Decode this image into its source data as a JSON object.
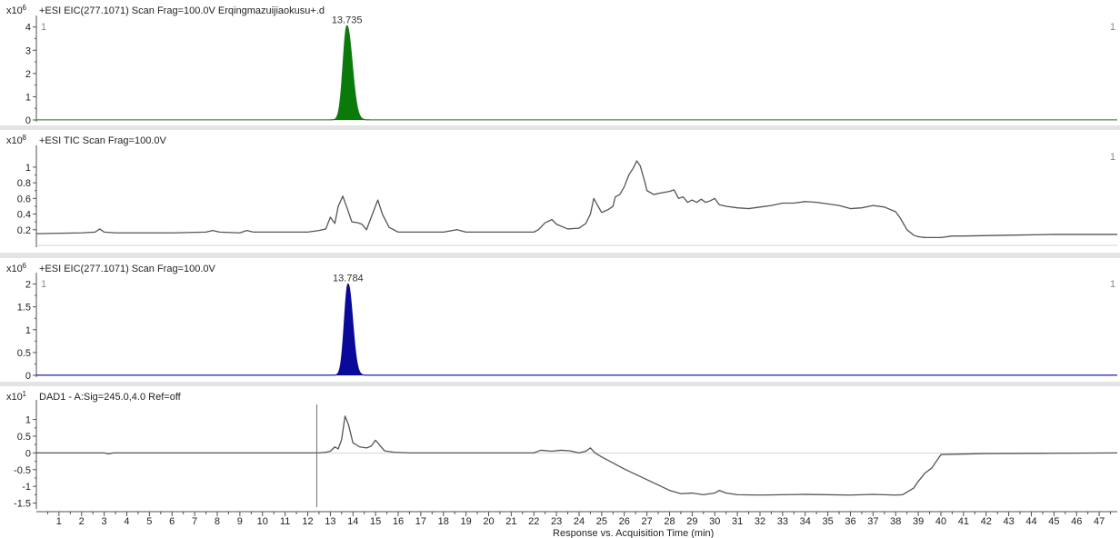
{
  "colors": {
    "panel_bg": "#ffffff",
    "separator_band": "#e4e4e4",
    "axis": "#505050",
    "trace_eic": "#1a7a1a",
    "fill_eic1": "#0a7a0a",
    "trace_tic": "#555555",
    "fill_eic2": "#0a0a9a",
    "trace_dad": "#555555",
    "marker": "#707070"
  },
  "x_axis": {
    "label": "Response vs. Acquisition Time (min)",
    "range": [
      0,
      47.8
    ],
    "ticks": [
      1,
      2,
      3,
      4,
      5,
      6,
      7,
      8,
      9,
      10,
      11,
      12,
      13,
      14,
      15,
      16,
      17,
      18,
      19,
      20,
      21,
      22,
      23,
      24,
      25,
      26,
      27,
      28,
      29,
      30,
      31,
      32,
      33,
      34,
      35,
      36,
      37,
      38,
      39,
      40,
      41,
      42,
      43,
      44,
      45,
      46,
      47
    ],
    "minor_step": 0.5
  },
  "chart_data": [
    {
      "type": "area",
      "title": "+ESI EIC(277.1071) Scan Frag=100.0V Erqingmazuijiaokusu+.d",
      "scale_label": "x10",
      "scale_exp": "6",
      "ylim": [
        0,
        4.3
      ],
      "yticks": [
        0,
        1,
        2,
        3,
        4
      ],
      "corner_left": "1",
      "corner_right": "1",
      "fill_color": "fill_eic1",
      "line_color": "trace_eic",
      "baseline": 0.005,
      "peaks": [
        {
          "rt": 13.735,
          "height": 4.05,
          "sigma_left": 0.17,
          "sigma_right": 0.23,
          "label": "13.735"
        }
      ],
      "fill_range": [
        13.1,
        15.3
      ],
      "noise": []
    },
    {
      "type": "line",
      "title": "+ESI TIC Scan Frag=100.0V",
      "scale_label": "x10",
      "scale_exp": "8",
      "ylim": [
        0,
        1.22
      ],
      "yticks": [
        0.2,
        0.4,
        0.6,
        0.8,
        1
      ],
      "corner_left": "",
      "corner_right": "1",
      "line_color": "trace_tic",
      "x": [
        0,
        2,
        2.6,
        2.8,
        3,
        3.5,
        6,
        7.5,
        7.8,
        8.1,
        9,
        9.3,
        9.6,
        12,
        12.5,
        12.8,
        13,
        13.2,
        13.35,
        13.55,
        13.75,
        13.95,
        14.2,
        14.4,
        14.6,
        14.9,
        15.1,
        15.3,
        15.6,
        16,
        18,
        18.6,
        19,
        20,
        22,
        22.2,
        22.5,
        22.8,
        23,
        23.5,
        24,
        24.3,
        24.5,
        24.65,
        24.8,
        25,
        25.3,
        25.5,
        25.6,
        25.8,
        26,
        26.2,
        26.4,
        26.55,
        26.7,
        26.9,
        27,
        27.3,
        27.6,
        28,
        28.2,
        28.4,
        28.6,
        28.8,
        29,
        29.2,
        29.4,
        29.6,
        29.8,
        30,
        30.2,
        30.5,
        31,
        31.5,
        32,
        32.5,
        33,
        33.5,
        34,
        34.5,
        35,
        35.5,
        36,
        36.5,
        37,
        37.5,
        38,
        38.2,
        38.5,
        38.8,
        39,
        39.3,
        39.6,
        40,
        40.5,
        41,
        43,
        45,
        47.8
      ],
      "y": [
        0.15,
        0.16,
        0.17,
        0.21,
        0.17,
        0.16,
        0.16,
        0.17,
        0.19,
        0.17,
        0.16,
        0.19,
        0.17,
        0.17,
        0.19,
        0.21,
        0.36,
        0.28,
        0.5,
        0.63,
        0.47,
        0.3,
        0.29,
        0.27,
        0.2,
        0.43,
        0.58,
        0.4,
        0.23,
        0.17,
        0.17,
        0.2,
        0.17,
        0.17,
        0.17,
        0.2,
        0.29,
        0.33,
        0.27,
        0.21,
        0.22,
        0.28,
        0.4,
        0.6,
        0.52,
        0.42,
        0.46,
        0.5,
        0.62,
        0.65,
        0.75,
        0.9,
        0.99,
        1.08,
        1.02,
        0.82,
        0.7,
        0.65,
        0.67,
        0.69,
        0.71,
        0.6,
        0.62,
        0.55,
        0.58,
        0.55,
        0.59,
        0.55,
        0.57,
        0.6,
        0.52,
        0.5,
        0.48,
        0.47,
        0.49,
        0.51,
        0.54,
        0.54,
        0.56,
        0.55,
        0.53,
        0.51,
        0.47,
        0.48,
        0.51,
        0.49,
        0.43,
        0.35,
        0.2,
        0.13,
        0.11,
        0.1,
        0.1,
        0.1,
        0.12,
        0.12,
        0.13,
        0.14,
        0.14
      ]
    },
    {
      "type": "area",
      "title": "+ESI EIC(277.1071) Scan Frag=100.0V",
      "scale_label": "x10",
      "scale_exp": "6",
      "ylim": [
        0,
        2.15
      ],
      "yticks": [
        0,
        0.5,
        1,
        1.5,
        2
      ],
      "corner_left": "1",
      "corner_right": "1",
      "fill_color": "fill_eic2",
      "line_color": "fill_eic2",
      "baseline": 0.003,
      "peaks": [
        {
          "rt": 13.784,
          "height": 2.0,
          "sigma_left": 0.16,
          "sigma_right": 0.2,
          "label": "13.784"
        }
      ],
      "fill_range": [
        13.1,
        14.7
      ],
      "noise": []
    },
    {
      "type": "line",
      "title": "DAD1 - A:Sig=245.0,4.0  Ref=off",
      "scale_label": "x10",
      "scale_exp": "1",
      "ylim": [
        -1.62,
        1.45
      ],
      "yticks": [
        -1.5,
        -1,
        -0.5,
        0,
        0.5,
        1
      ],
      "corner_left": "",
      "corner_right": "",
      "marker_rt": 12.4,
      "line_color": "trace_dad",
      "x": [
        0,
        3,
        3.2,
        3.4,
        12.5,
        12.8,
        13,
        13.2,
        13.35,
        13.5,
        13.65,
        13.8,
        14,
        14.3,
        14.6,
        14.8,
        15,
        15.2,
        15.4,
        15.8,
        16.5,
        20,
        22,
        22.3,
        22.8,
        23.2,
        23.6,
        24,
        24.3,
        24.5,
        24.7,
        25,
        25.5,
        26,
        27,
        28,
        28.5,
        29,
        29.5,
        30,
        30.2,
        30.5,
        31,
        32,
        34,
        36,
        37,
        38,
        38.3,
        38.8,
        39,
        39.3,
        39.6,
        40,
        42,
        45,
        47.8
      ],
      "y": [
        0,
        0,
        -0.03,
        0,
        0,
        0.02,
        0.05,
        0.18,
        0.12,
        0.4,
        1.1,
        0.85,
        0.3,
        0.18,
        0.15,
        0.2,
        0.38,
        0.22,
        0.06,
        0.02,
        0,
        0,
        0,
        0.08,
        0.05,
        0.08,
        0.06,
        0,
        0.05,
        0.15,
        0,
        -0.12,
        -0.3,
        -0.48,
        -0.8,
        -1.12,
        -1.22,
        -1.2,
        -1.25,
        -1.2,
        -1.12,
        -1.2,
        -1.25,
        -1.26,
        -1.24,
        -1.26,
        -1.24,
        -1.26,
        -1.25,
        -1.05,
        -0.85,
        -0.6,
        -0.45,
        -0.05,
        -0.02,
        -0.01,
        0
      ]
    }
  ]
}
